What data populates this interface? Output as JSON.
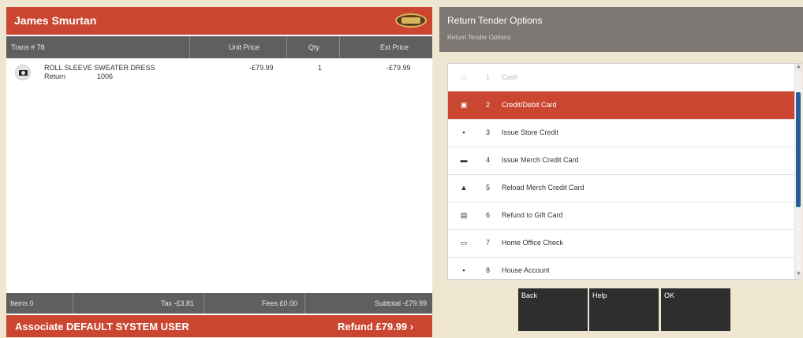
{
  "customer": {
    "name": "James Smurtan"
  },
  "transaction": {
    "columns": {
      "trans": "Trans # 78",
      "unit_price": "Unit Price",
      "qty": "Qty",
      "ext_price": "Ext Price"
    },
    "items": [
      {
        "description": "ROLL SLEEVE SWEATER DRESS",
        "type": "Return",
        "code": "1006",
        "unit_price": "-£79.99",
        "qty": "1",
        "ext_price": "-£79.99"
      }
    ]
  },
  "footer": {
    "items": "Items 0",
    "tax": "Tax -£3.81",
    "fees": "Fees £0.00",
    "subtotal": "Subtotal -£79.99",
    "associate": "Associate DEFAULT SYSTEM USER",
    "refund": "Refund £79.99 ›"
  },
  "tender": {
    "title": "Return Tender Options",
    "subtitle": "Return Tender Options",
    "options": [
      {
        "num": "1",
        "label": "Cash",
        "icon": "cash-icon"
      },
      {
        "num": "2",
        "label": "Credit/Debit Card",
        "icon": "card-icon"
      },
      {
        "num": "3",
        "label": "Issue Store Credit",
        "icon": "store-credit-icon"
      },
      {
        "num": "4",
        "label": "Issue Merch Credit Card",
        "icon": "merch-card-icon"
      },
      {
        "num": "5",
        "label": "Reload Merch Credit Card",
        "icon": "reload-icon"
      },
      {
        "num": "6",
        "label": "Refund to Gift Card",
        "icon": "gift-card-icon"
      },
      {
        "num": "7",
        "label": "Home Office Check",
        "icon": "check-icon"
      },
      {
        "num": "8",
        "label": "House Account",
        "icon": "house-account-icon"
      }
    ]
  },
  "actions": {
    "back": "Back",
    "help": "Help",
    "ok": "OK"
  },
  "colors": {
    "accent": "#cb4630",
    "dark": "#5f5f5f",
    "header": "#7d7873",
    "scrollbar": "#2a5c9a"
  }
}
